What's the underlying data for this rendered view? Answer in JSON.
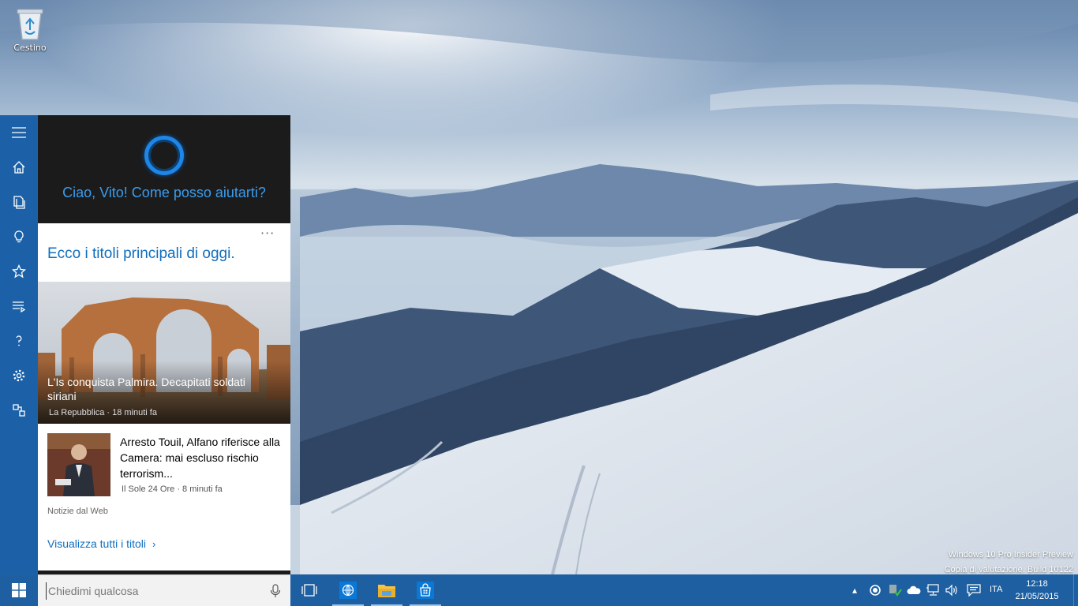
{
  "desktop": {
    "recycle_bin_label": "Cestino",
    "watermark_line1": "Windows 10 Pro Insider Preview",
    "watermark_line2": "Copia di valutazione. Build 10122"
  },
  "sidebar": {
    "items": [
      {
        "name": "menu",
        "icon": "hamburger-icon"
      },
      {
        "name": "home",
        "icon": "home-icon"
      },
      {
        "name": "notebook",
        "icon": "notebook-icon"
      },
      {
        "name": "reminders",
        "icon": "lightbulb-icon"
      },
      {
        "name": "favorites",
        "icon": "star-icon"
      },
      {
        "name": "news",
        "icon": "news-icon"
      },
      {
        "name": "help",
        "icon": "help-icon"
      },
      {
        "name": "settings",
        "icon": "gear-icon"
      },
      {
        "name": "feedback",
        "icon": "feedback-icon"
      }
    ]
  },
  "cortana": {
    "greeting": "Ciao, Vito! Come posso aiutarti?",
    "headlines_title": "Ecco i titoli principali di oggi.",
    "more_label": "···",
    "stories": [
      {
        "title": "L'Is conquista Palmira. Decapitati soldati siriani",
        "source": "La Repubblica",
        "age": "18 minuti fa"
      },
      {
        "title": "Arresto Touil, Alfano riferisce alla Camera: mai escluso rischio terrorism...",
        "source": "Il Sole 24 Ore",
        "age": "8 minuti fa"
      }
    ],
    "story1_meta": "La Repubblica · 18 minuti fa",
    "story2_meta": "Il Sole 24 Ore · 8 minuti fa",
    "source_note": "Notizie dal Web",
    "see_all": "Visualizza tutti i titoli",
    "see_all_chevron": "›"
  },
  "taskbar": {
    "search_placeholder": "Chiedimi qualcosa",
    "pinned": [
      {
        "name": "task-view",
        "icon": "task-view-icon"
      },
      {
        "name": "browser",
        "icon": "globe-icon"
      },
      {
        "name": "file-explorer",
        "icon": "folder-icon"
      },
      {
        "name": "store",
        "icon": "store-icon"
      }
    ],
    "tray": {
      "chevron": "▴",
      "language": "ITA",
      "time": "12:18",
      "date": "21/05/2015"
    }
  },
  "colors": {
    "accent": "#1c61a8",
    "cortana_blue": "#1e86e6",
    "link_blue": "#106ebe",
    "taskbar": "#1d5fa0"
  }
}
